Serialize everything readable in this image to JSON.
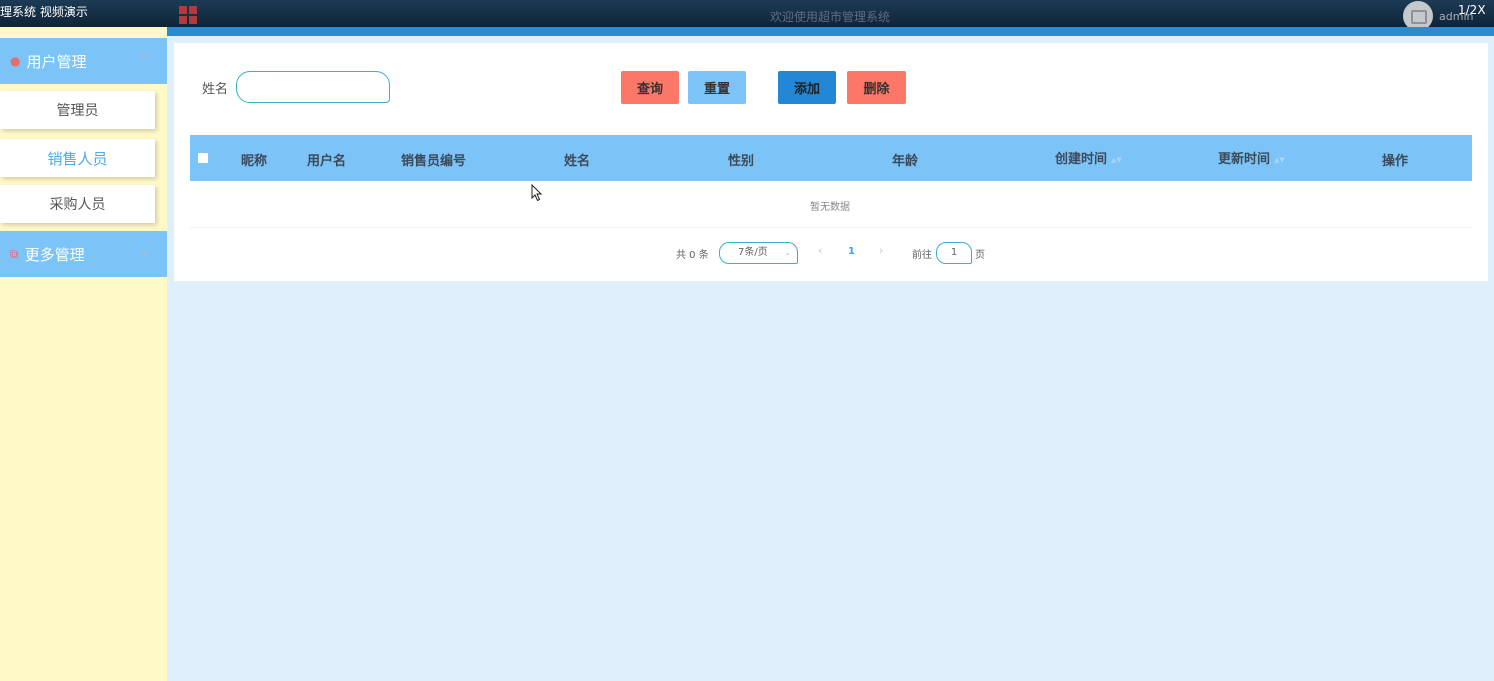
{
  "header": {
    "video_caption": "理系统 视频演示",
    "welcome": "欢迎使用超市管理系统",
    "username": "admin",
    "page_indicator": "1/2X"
  },
  "sidebar": {
    "groups": [
      {
        "label": "用户管理",
        "icon": "user-icon",
        "chevron": "chevron-up-icon"
      },
      {
        "label": "更多管理",
        "icon": "copy-icon",
        "chevron": "chevron-down-icon"
      }
    ],
    "items": [
      {
        "label": "管理员",
        "active": false
      },
      {
        "label": "销售人员",
        "active": true
      },
      {
        "label": "采购人员",
        "active": false
      }
    ]
  },
  "search": {
    "label": "姓名",
    "value": "",
    "placeholder": ""
  },
  "toolbar": {
    "query_label": "查询",
    "reset_label": "重置",
    "add_label": "添加",
    "delete_label": "删除"
  },
  "table": {
    "columns": [
      "昵称",
      "用户名",
      "销售员编号",
      "姓名",
      "性别",
      "年龄",
      "创建时间",
      "更新时间",
      "操作"
    ],
    "rows": [],
    "empty_text": "暂无数据"
  },
  "pagination": {
    "total_text": "共 0 条",
    "page_size": "7条/页",
    "current_page": "1",
    "goto_label": "前往",
    "goto_value": "1",
    "page_unit": "页"
  },
  "colors": {
    "menu_blue": "#7cc4f8",
    "sidebar_bg": "#fff9c7",
    "accent_red": "#fd7768",
    "add_blue": "#2487d6",
    "page_bg": "#dff0fc"
  }
}
